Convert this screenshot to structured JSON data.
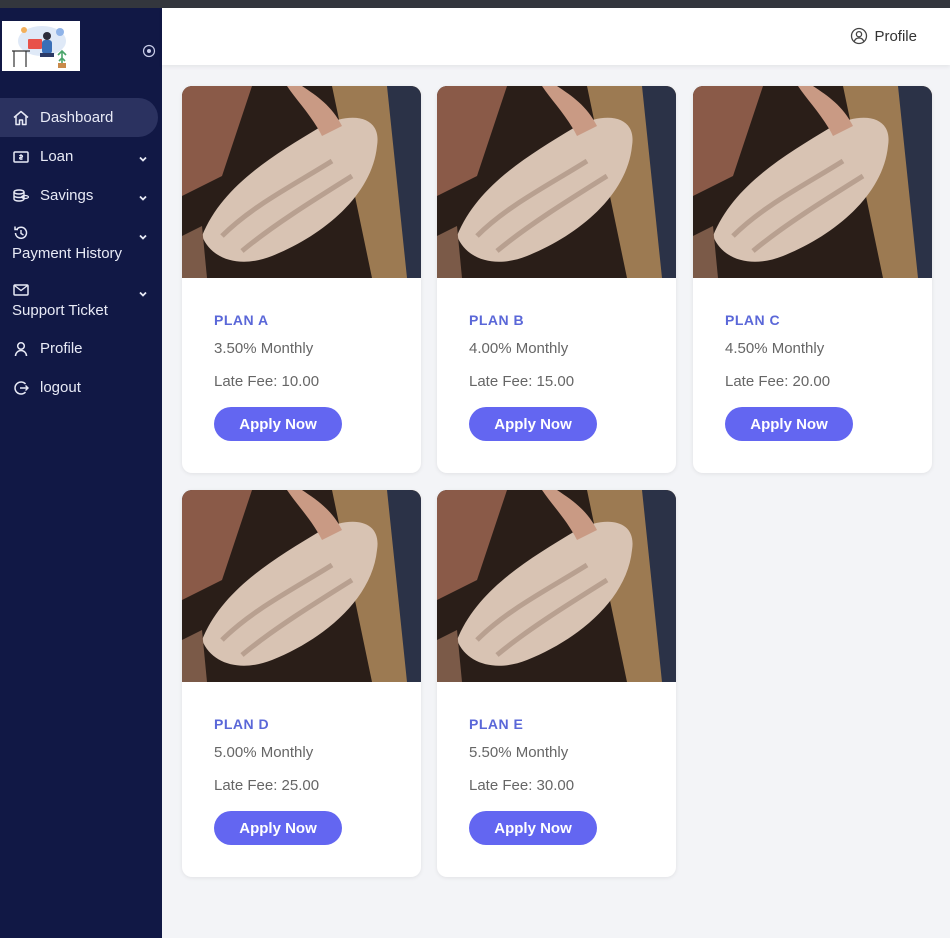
{
  "header": {
    "profile_label": "Profile"
  },
  "sidebar": {
    "items": [
      {
        "label": "Dashboard",
        "icon": "home-icon",
        "active": true
      },
      {
        "label": "Loan",
        "icon": "loan-icon",
        "has_submenu": true
      },
      {
        "label": "Savings",
        "icon": "savings-icon",
        "has_submenu": true
      },
      {
        "label": "Payment History",
        "icon": "history-icon",
        "has_submenu": true
      },
      {
        "label": "Support Ticket",
        "icon": "mail-icon",
        "has_submenu": true
      },
      {
        "label": "Profile",
        "icon": "user-icon"
      },
      {
        "label": "logout",
        "icon": "logout-icon"
      }
    ]
  },
  "plans": [
    {
      "name": "PLAN A",
      "rate": "3.50% Monthly",
      "late_fee": "Late Fee: 10.00",
      "button": "Apply Now"
    },
    {
      "name": "PLAN B",
      "rate": "4.00% Monthly",
      "late_fee": "Late Fee: 15.00",
      "button": "Apply Now"
    },
    {
      "name": "PLAN C",
      "rate": "4.50% Monthly",
      "late_fee": "Late Fee: 20.00",
      "button": "Apply Now"
    },
    {
      "name": "PLAN D",
      "rate": "5.00% Monthly",
      "late_fee": "Late Fee: 25.00",
      "button": "Apply Now"
    },
    {
      "name": "PLAN E",
      "rate": "5.50% Monthly",
      "late_fee": "Late Fee: 30.00",
      "button": "Apply Now"
    }
  ],
  "colors": {
    "sidebar_bg": "#111845",
    "accent": "#6366f1",
    "plan_title": "#5a67d8",
    "page_bg": "#f3f4f7"
  }
}
